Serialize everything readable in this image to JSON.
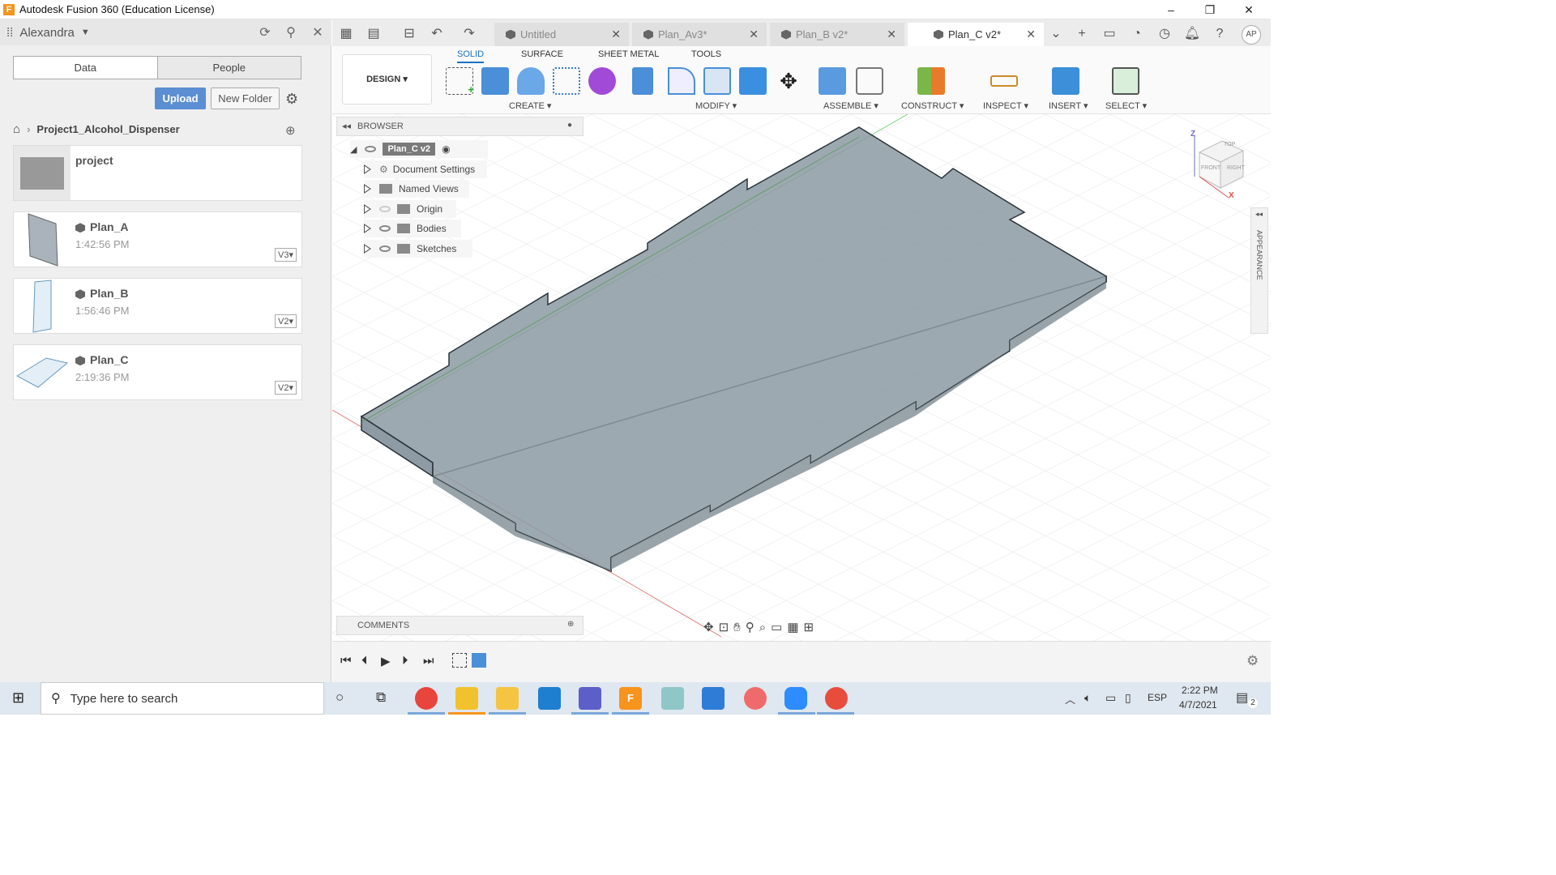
{
  "window": {
    "title": "Autodesk Fusion 360 (Education License)",
    "minimize": "–",
    "restore": "❐",
    "close": "✕"
  },
  "left_panel": {
    "user": "Alexandra",
    "tabs": [
      "Data",
      "People"
    ],
    "upload_label": "Upload",
    "new_folder_label": "New Folder",
    "breadcrumb": "Project1_Alcohol_Dispenser",
    "folder": {
      "name": "project"
    },
    "files": [
      {
        "name": "Plan_A",
        "time": "1:42:56 PM",
        "version": "V3▾"
      },
      {
        "name": "Plan_B",
        "time": "1:56:46 PM",
        "version": "V2▾"
      },
      {
        "name": "Plan_C",
        "time": "2:19:36 PM",
        "version": "V2▾"
      }
    ]
  },
  "doc_tabs": [
    {
      "label": "Untitled",
      "active": false
    },
    {
      "label": "Plan_Av3*",
      "active": false
    },
    {
      "label": "Plan_B v2*",
      "active": false
    },
    {
      "label": "Plan_C v2*",
      "active": true
    }
  ],
  "avatar": "AP",
  "toolbar": {
    "workspace": "DESIGN ▾",
    "tabs": [
      "SOLID",
      "SURFACE",
      "SHEET METAL",
      "TOOLS"
    ],
    "groups": [
      "CREATE ▾",
      "MODIFY ▾",
      "ASSEMBLE ▾",
      "CONSTRUCT ▾",
      "INSPECT ▾",
      "INSERT ▾",
      "SELECT ▾"
    ]
  },
  "browser": {
    "title": "BROWSER",
    "root": "Plan_C v2",
    "items": [
      "Document Settings",
      "Named Views",
      "Origin",
      "Bodies",
      "Sketches"
    ]
  },
  "comments": {
    "title": "COMMENTS"
  },
  "viewcube": {
    "top": "TOP",
    "front": "FRONT",
    "right": "RIGHT",
    "z": "Z",
    "x": "X"
  },
  "appearance_label": "APPEARANCE",
  "taskbar": {
    "search_placeholder": "Type here to search",
    "language": "ESP",
    "time": "2:22 PM",
    "date": "4/7/2021",
    "notifications": "2"
  },
  "colors": {
    "accent": "#1b72c4",
    "upload": "#5b8ed2",
    "plate_fill": "#8c9aa3"
  }
}
